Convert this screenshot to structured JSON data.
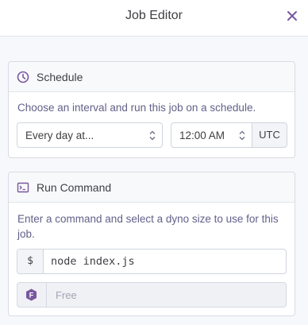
{
  "header": {
    "title": "Job Editor",
    "close_icon": "close-icon"
  },
  "schedule": {
    "title": "Schedule",
    "icon": "clock-icon",
    "description": "Choose an interval and run this job on a schedule.",
    "interval_value": "Every day at...",
    "time_value": "12:00 AM",
    "timezone": "UTC"
  },
  "run_command": {
    "title": "Run Command",
    "icon": "terminal-icon",
    "description": "Enter a command and select a dyno size to use for this job.",
    "prefix": "$",
    "command_value": "node index.js",
    "dyno_badge": "F",
    "dyno_size": "Free"
  },
  "colors": {
    "accent": "#79589f",
    "text": "#3f3f44",
    "muted": "#63608a"
  }
}
